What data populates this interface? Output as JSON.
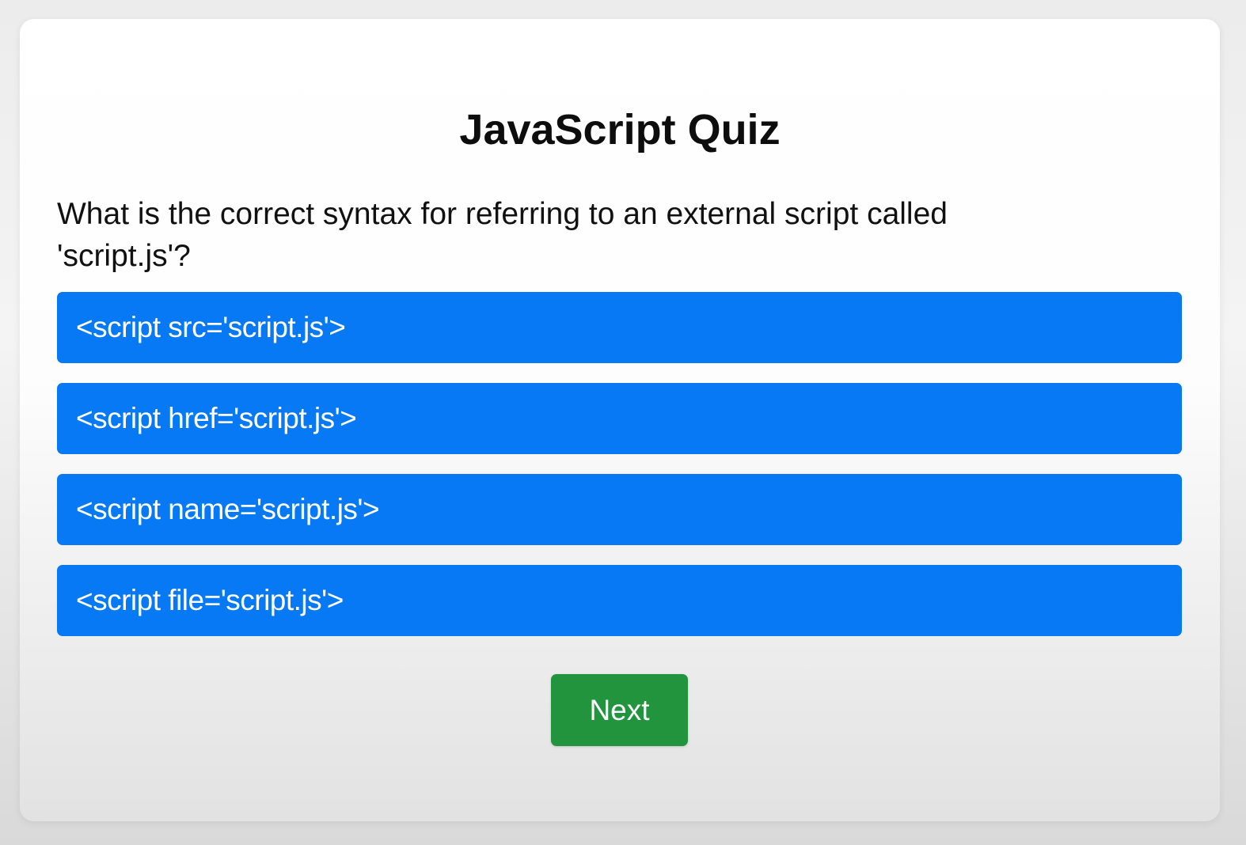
{
  "quiz": {
    "title": "JavaScript Quiz",
    "question": "What is the correct syntax for referring to an external script called 'script.js'?",
    "answers": [
      "<script src='script.js'>",
      "<script href='script.js'>",
      "<script name='script.js'>",
      "<script file='script.js'>"
    ],
    "next_label": "Next"
  },
  "colors": {
    "answer_button": "#0779f5",
    "next_button": "#22943e",
    "title_text": "#0d0d0d",
    "card_background": "#ffffff"
  }
}
